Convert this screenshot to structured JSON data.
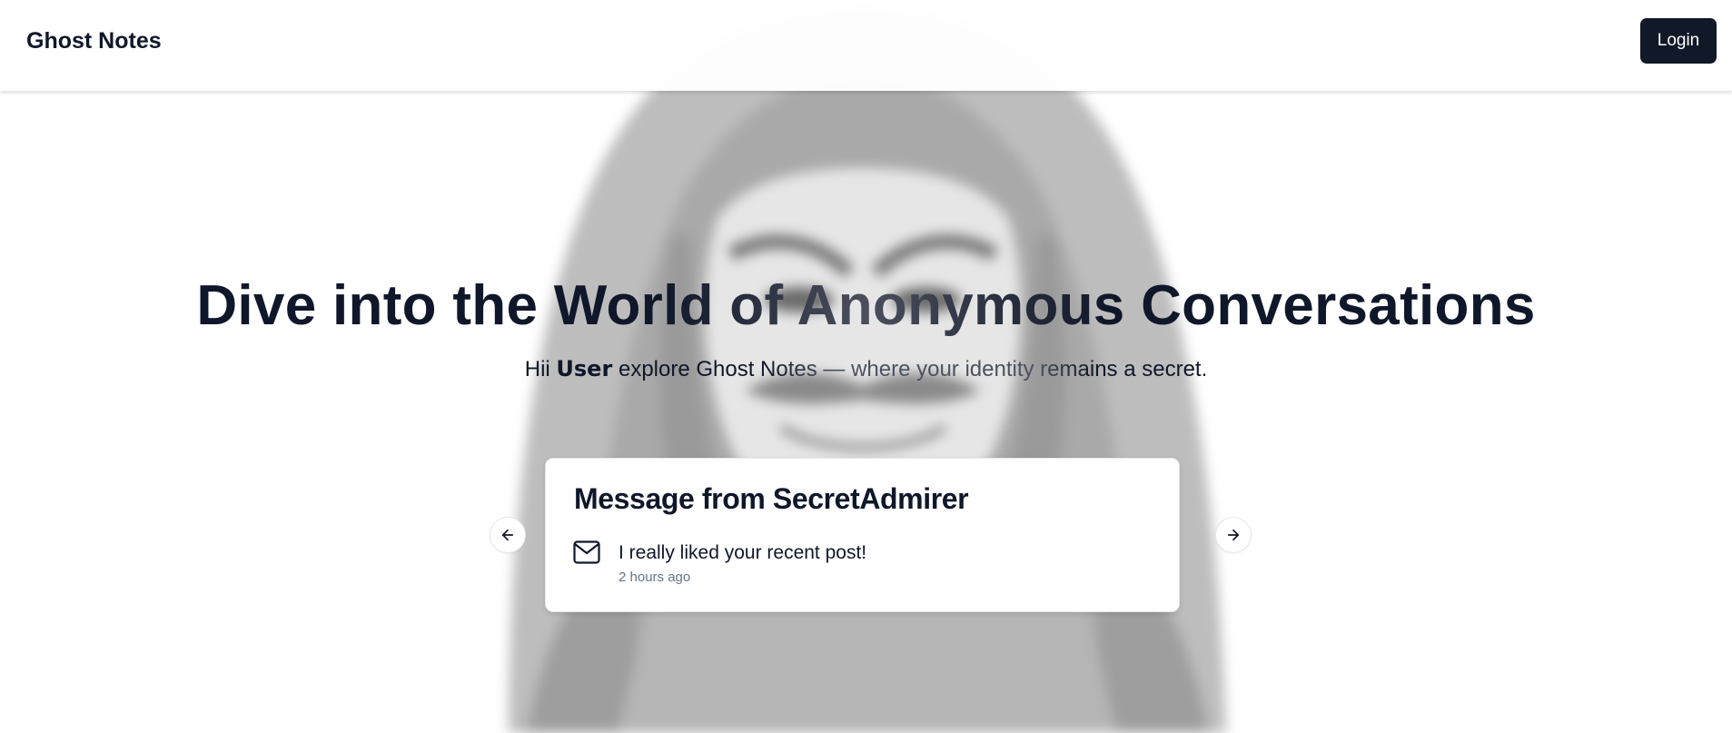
{
  "navbar": {
    "brand": "Ghost Notes",
    "login_label": "Login"
  },
  "hero": {
    "title": "Dive into the World of Anonymous Conversations",
    "subtitle_prefix": "Hii ",
    "subtitle_user": "User",
    "subtitle_suffix": " explore Ghost Notes — where your identity remains a secret."
  },
  "carousel": {
    "card": {
      "title": "Message from SecretAdmirer",
      "message": "I really liked your recent post!",
      "time": "2 hours ago",
      "icon": "mail-icon"
    },
    "prev_icon": "arrow-left-icon",
    "next_icon": "arrow-right-icon"
  },
  "colors": {
    "text": "#0f172a",
    "button_bg": "#111827",
    "muted": "#64748b",
    "background": "#ffffff"
  }
}
